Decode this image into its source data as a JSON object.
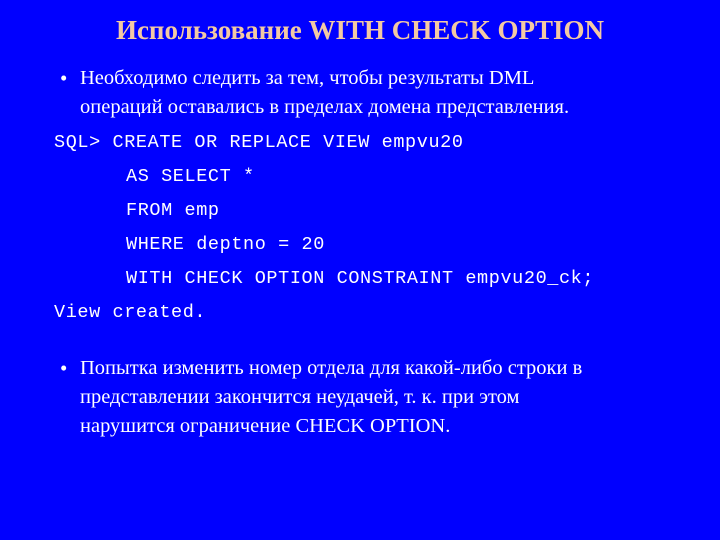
{
  "slide": {
    "background_color": "#0000FF",
    "title_color": "#F3C9A3",
    "body_color": "#FFFFFF",
    "title": "Использование WITH CHECK OPTION",
    "bullet_glyph": "•",
    "bullets_top": [
      {
        "lines": [
          "Необходимо следить за тем, чтобы результаты DML",
          "операций оставались в пределах домена представления."
        ]
      }
    ],
    "code": {
      "lines": [
        {
          "text": "SQL> CREATE OR REPLACE VIEW empvu20",
          "indented": false
        },
        {
          "text": "AS SELECT *",
          "indented": true
        },
        {
          "text": "FROM emp",
          "indented": true
        },
        {
          "text": "WHERE deptno = 20",
          "indented": true
        },
        {
          "text": "WITH CHECK OPTION CONSTRAINT empvu20_ck;",
          "indented": true
        },
        {
          "text": "View created.",
          "indented": false
        }
      ]
    },
    "bullets_bottom": [
      {
        "lines": [
          "Попытка изменить номер отдела для какой-либо строки в",
          "представлении закончится неудачей, т. к. при этом",
          "нарушится ограничение CHECK OPTION."
        ]
      }
    ]
  }
}
